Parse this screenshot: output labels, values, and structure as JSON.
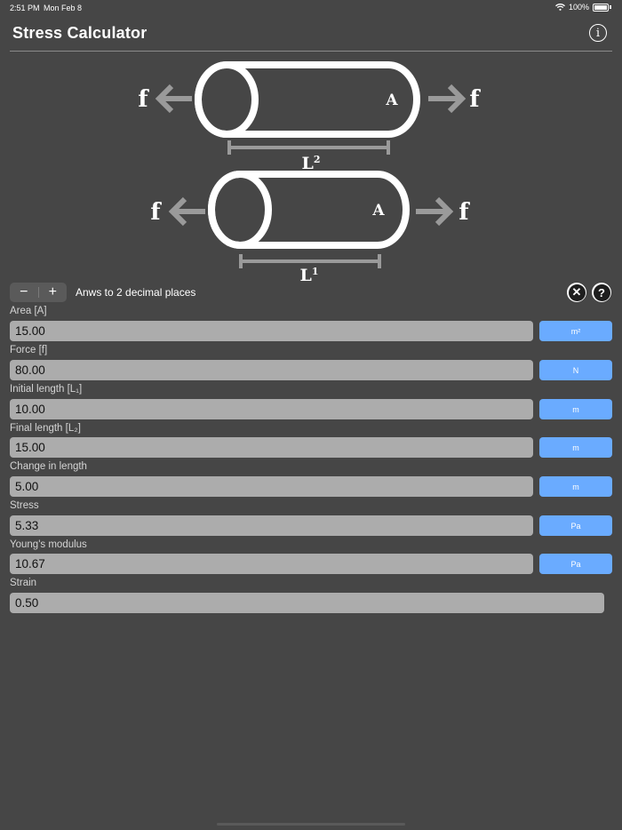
{
  "status_bar": {
    "time": "2:51 PM",
    "date": "Mon Feb 8",
    "battery": "100%"
  },
  "header": {
    "title": "Stress Calculator",
    "info_icon": "info-icon"
  },
  "diagram": {
    "force_label": "f",
    "area_label": "A",
    "length_top_label": "L",
    "length_top_sub": "2",
    "length_bottom_label": "L",
    "length_bottom_sub": "1"
  },
  "controls": {
    "minus_label": "−",
    "plus_label": "+",
    "precision_label": "Anws to 2 decimal places",
    "clear_label": "✕",
    "help_label": "?"
  },
  "fields": [
    {
      "label": "Area [A]",
      "value": "15.00",
      "unit": "m²"
    },
    {
      "label": "Force [f]",
      "value": "80.00",
      "unit": "N"
    },
    {
      "label": "Initial length [L₁]",
      "value": "10.00",
      "unit": "m"
    },
    {
      "label": "Final length [L₂]",
      "value": "15.00",
      "unit": "m"
    },
    {
      "label": "Change in length",
      "value": "5.00",
      "unit": "m"
    },
    {
      "label": "Stress",
      "value": "5.33",
      "unit": "Pa"
    },
    {
      "label": "Young's modulus",
      "value": "10.67",
      "unit": "Pa"
    },
    {
      "label": "Strain",
      "value": "0.50"
    }
  ]
}
